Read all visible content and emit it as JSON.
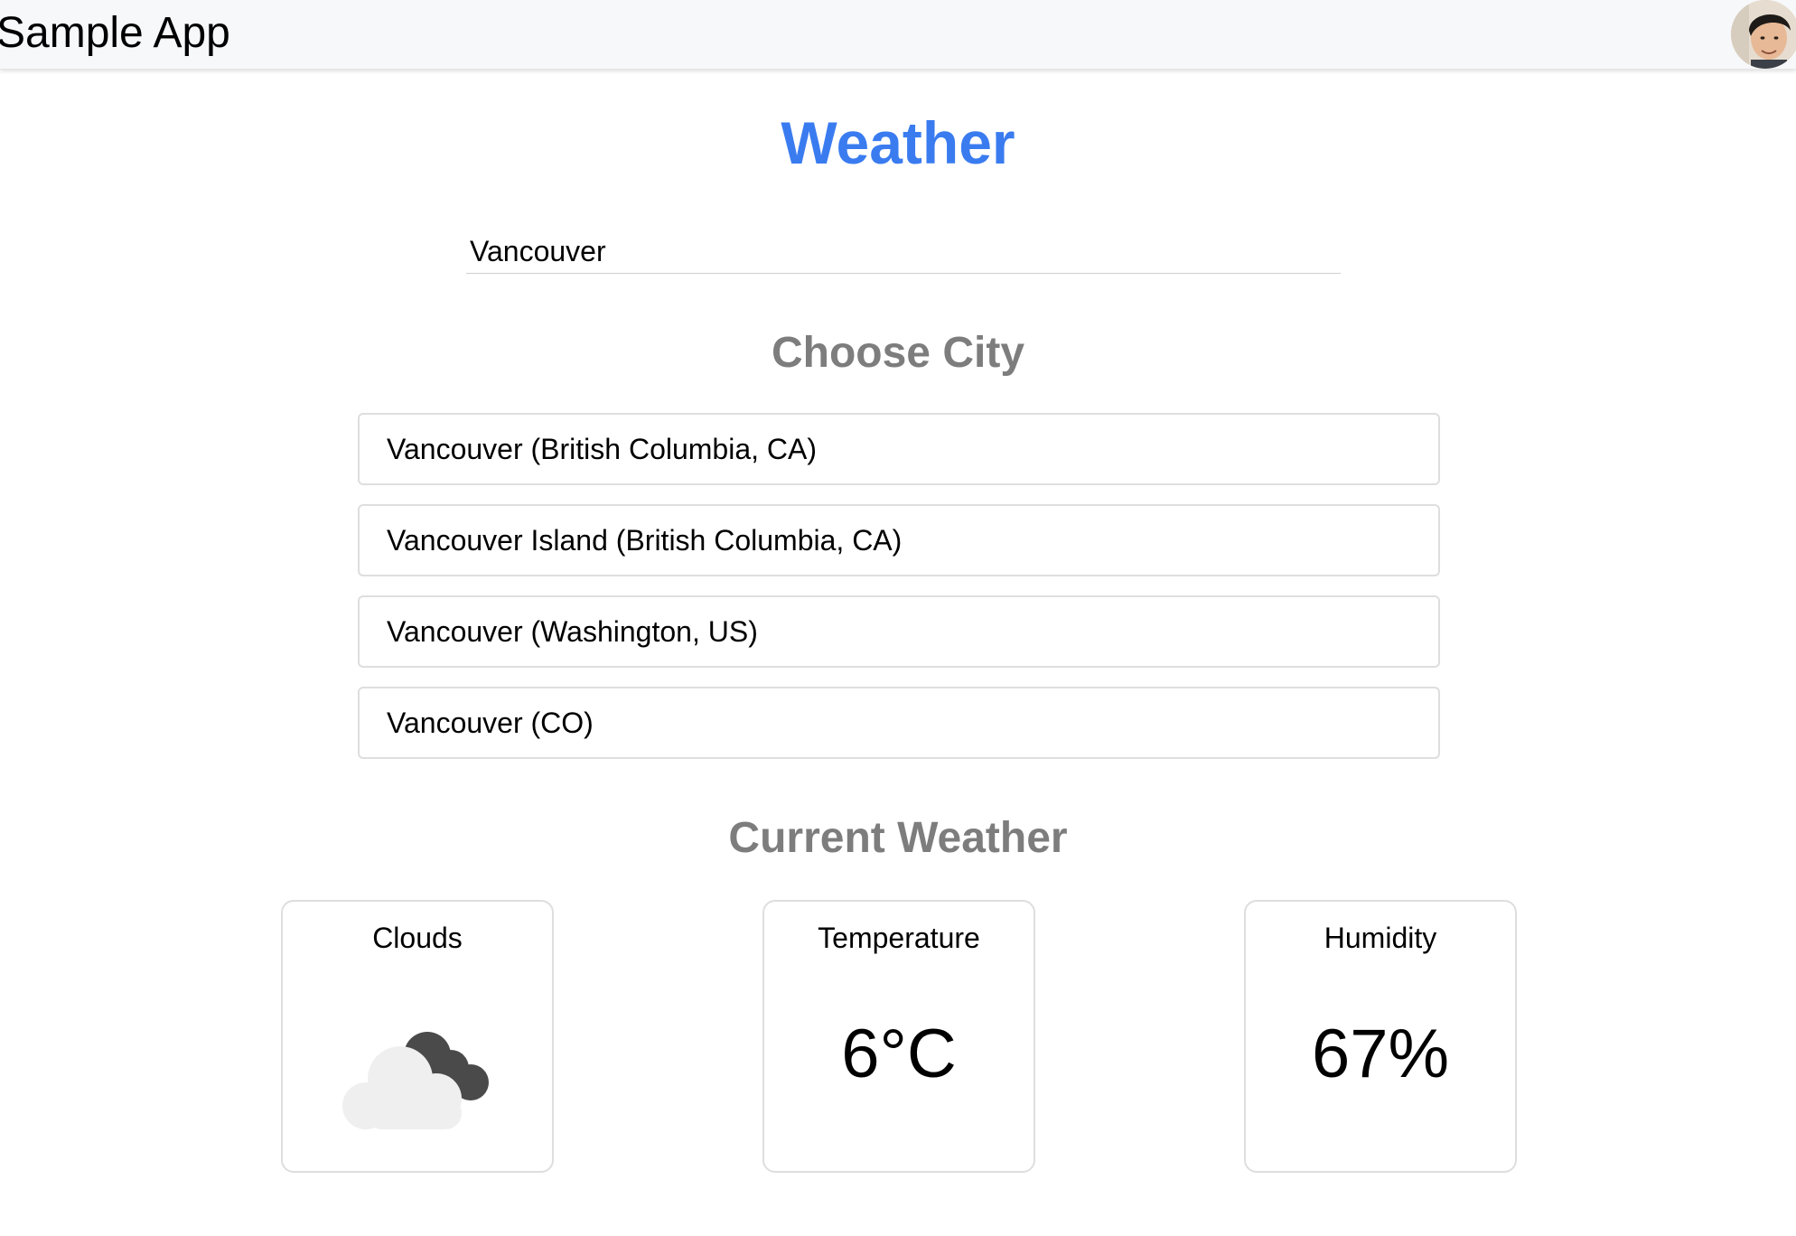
{
  "header": {
    "app_title": "Sample App",
    "avatar_icon": "user-avatar"
  },
  "main": {
    "title": "Weather",
    "title_color": "#3a7cf0",
    "search": {
      "value": "Vancouver",
      "placeholder": ""
    },
    "choose_city_heading": "Choose City",
    "cities": [
      {
        "label": "Vancouver (British Columbia, CA)"
      },
      {
        "label": "Vancouver Island (British Columbia, CA)"
      },
      {
        "label": "Vancouver (Washington, US)"
      },
      {
        "label": "Vancouver (CO)"
      }
    ],
    "current_weather_heading": "Current Weather",
    "cards": {
      "clouds": {
        "label": "Clouds",
        "icon": "cloud-icon"
      },
      "temperature": {
        "label": "Temperature",
        "value": "6°C"
      },
      "humidity": {
        "label": "Humidity",
        "value": "67%"
      }
    }
  }
}
